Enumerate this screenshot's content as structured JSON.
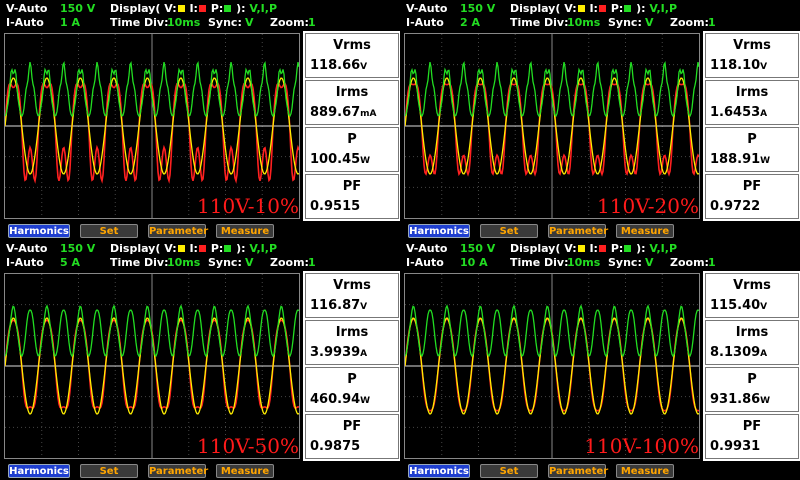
{
  "panels": [
    {
      "v_range_label": "V-Auto",
      "v_range": "150 V",
      "i_range_label": "I-Auto",
      "i_range": "1 A",
      "display_label": "Display( V:",
      "display_i": "I:",
      "display_p": "P:",
      "display_close": "):",
      "display_value": "V,I,P",
      "time_div_label": "Time Div:",
      "time_div": "10ms",
      "sync_label": "Sync:",
      "sync": "V",
      "zoom_label": "Zoom:",
      "zoom": "1",
      "caption": "110V-10%",
      "vrms_label": "Vrms",
      "vrms": "118.66",
      "vrms_unit": "V",
      "irms_label": "Irms",
      "irms": "889.67",
      "irms_unit": "mA",
      "p_label": "P",
      "p": "100.45",
      "p_unit": "W",
      "pf_label": "PF",
      "pf": "0.9515",
      "buttons": [
        "Harmonics",
        "Set",
        "Parameter",
        "Measure"
      ]
    },
    {
      "v_range_label": "V-Auto",
      "v_range": "150 V",
      "i_range_label": "I-Auto",
      "i_range": "2 A",
      "display_label": "Display( V:",
      "display_i": "I:",
      "display_p": "P:",
      "display_close": "):",
      "display_value": "V,I,P",
      "time_div_label": "Time Div:",
      "time_div": "10ms",
      "sync_label": "Sync:",
      "sync": "V",
      "zoom_label": "Zoom:",
      "zoom": "1",
      "caption": "110V-20%",
      "vrms_label": "Vrms",
      "vrms": "118.10",
      "vrms_unit": "V",
      "irms_label": "Irms",
      "irms": "1.6453",
      "irms_unit": "A",
      "p_label": "P",
      "p": "188.91",
      "p_unit": "W",
      "pf_label": "PF",
      "pf": "0.9722",
      "buttons": [
        "Harmonics",
        "Set",
        "Parameter",
        "Measure"
      ]
    },
    {
      "v_range_label": "V-Auto",
      "v_range": "150 V",
      "i_range_label": "I-Auto",
      "i_range": "5 A",
      "display_label": "Display( V:",
      "display_i": "I:",
      "display_p": "P:",
      "display_close": "):",
      "display_value": "V,I,P",
      "time_div_label": "Time Div:",
      "time_div": "10ms",
      "sync_label": "Sync:",
      "sync": "V",
      "zoom_label": "Zoom:",
      "zoom": "1",
      "caption": "110V-50%",
      "vrms_label": "Vrms",
      "vrms": "116.87",
      "vrms_unit": "V",
      "irms_label": "Irms",
      "irms": "3.9939",
      "irms_unit": "A",
      "p_label": "P",
      "p": "460.94",
      "p_unit": "W",
      "pf_label": "PF",
      "pf": "0.9875",
      "buttons": [
        "Harmonics",
        "Set",
        "Parameter",
        "Measure"
      ]
    },
    {
      "v_range_label": "V-Auto",
      "v_range": "150 V",
      "i_range_label": "I-Auto",
      "i_range": "10 A",
      "display_label": "Display( V:",
      "display_i": "I:",
      "display_p": "P:",
      "display_close": "):",
      "display_value": "V,I,P",
      "time_div_label": "Time Div:",
      "time_div": "10ms",
      "sync_label": "Sync:",
      "sync": "V",
      "zoom_label": "Zoom:",
      "zoom": "1",
      "caption": "110V-100%",
      "vrms_label": "Vrms",
      "vrms": "115.40",
      "vrms_unit": "V",
      "irms_label": "Irms",
      "irms": "8.1309",
      "irms_unit": "A",
      "p_label": "P",
      "p": "931.86",
      "p_unit": "W",
      "pf_label": "PF",
      "pf": "0.9931",
      "buttons": [
        "Harmonics",
        "Set",
        "Parameter",
        "Measure"
      ]
    }
  ],
  "colors": {
    "voltage_trace": "#ffee00",
    "current_trace": "#ff2020",
    "power_trace": "#22dd22",
    "range_text": "#22dd22",
    "caption_text": "#ff1a1a",
    "harmonics_button": "#1f3fd0",
    "button_text": "#ffa500"
  }
}
